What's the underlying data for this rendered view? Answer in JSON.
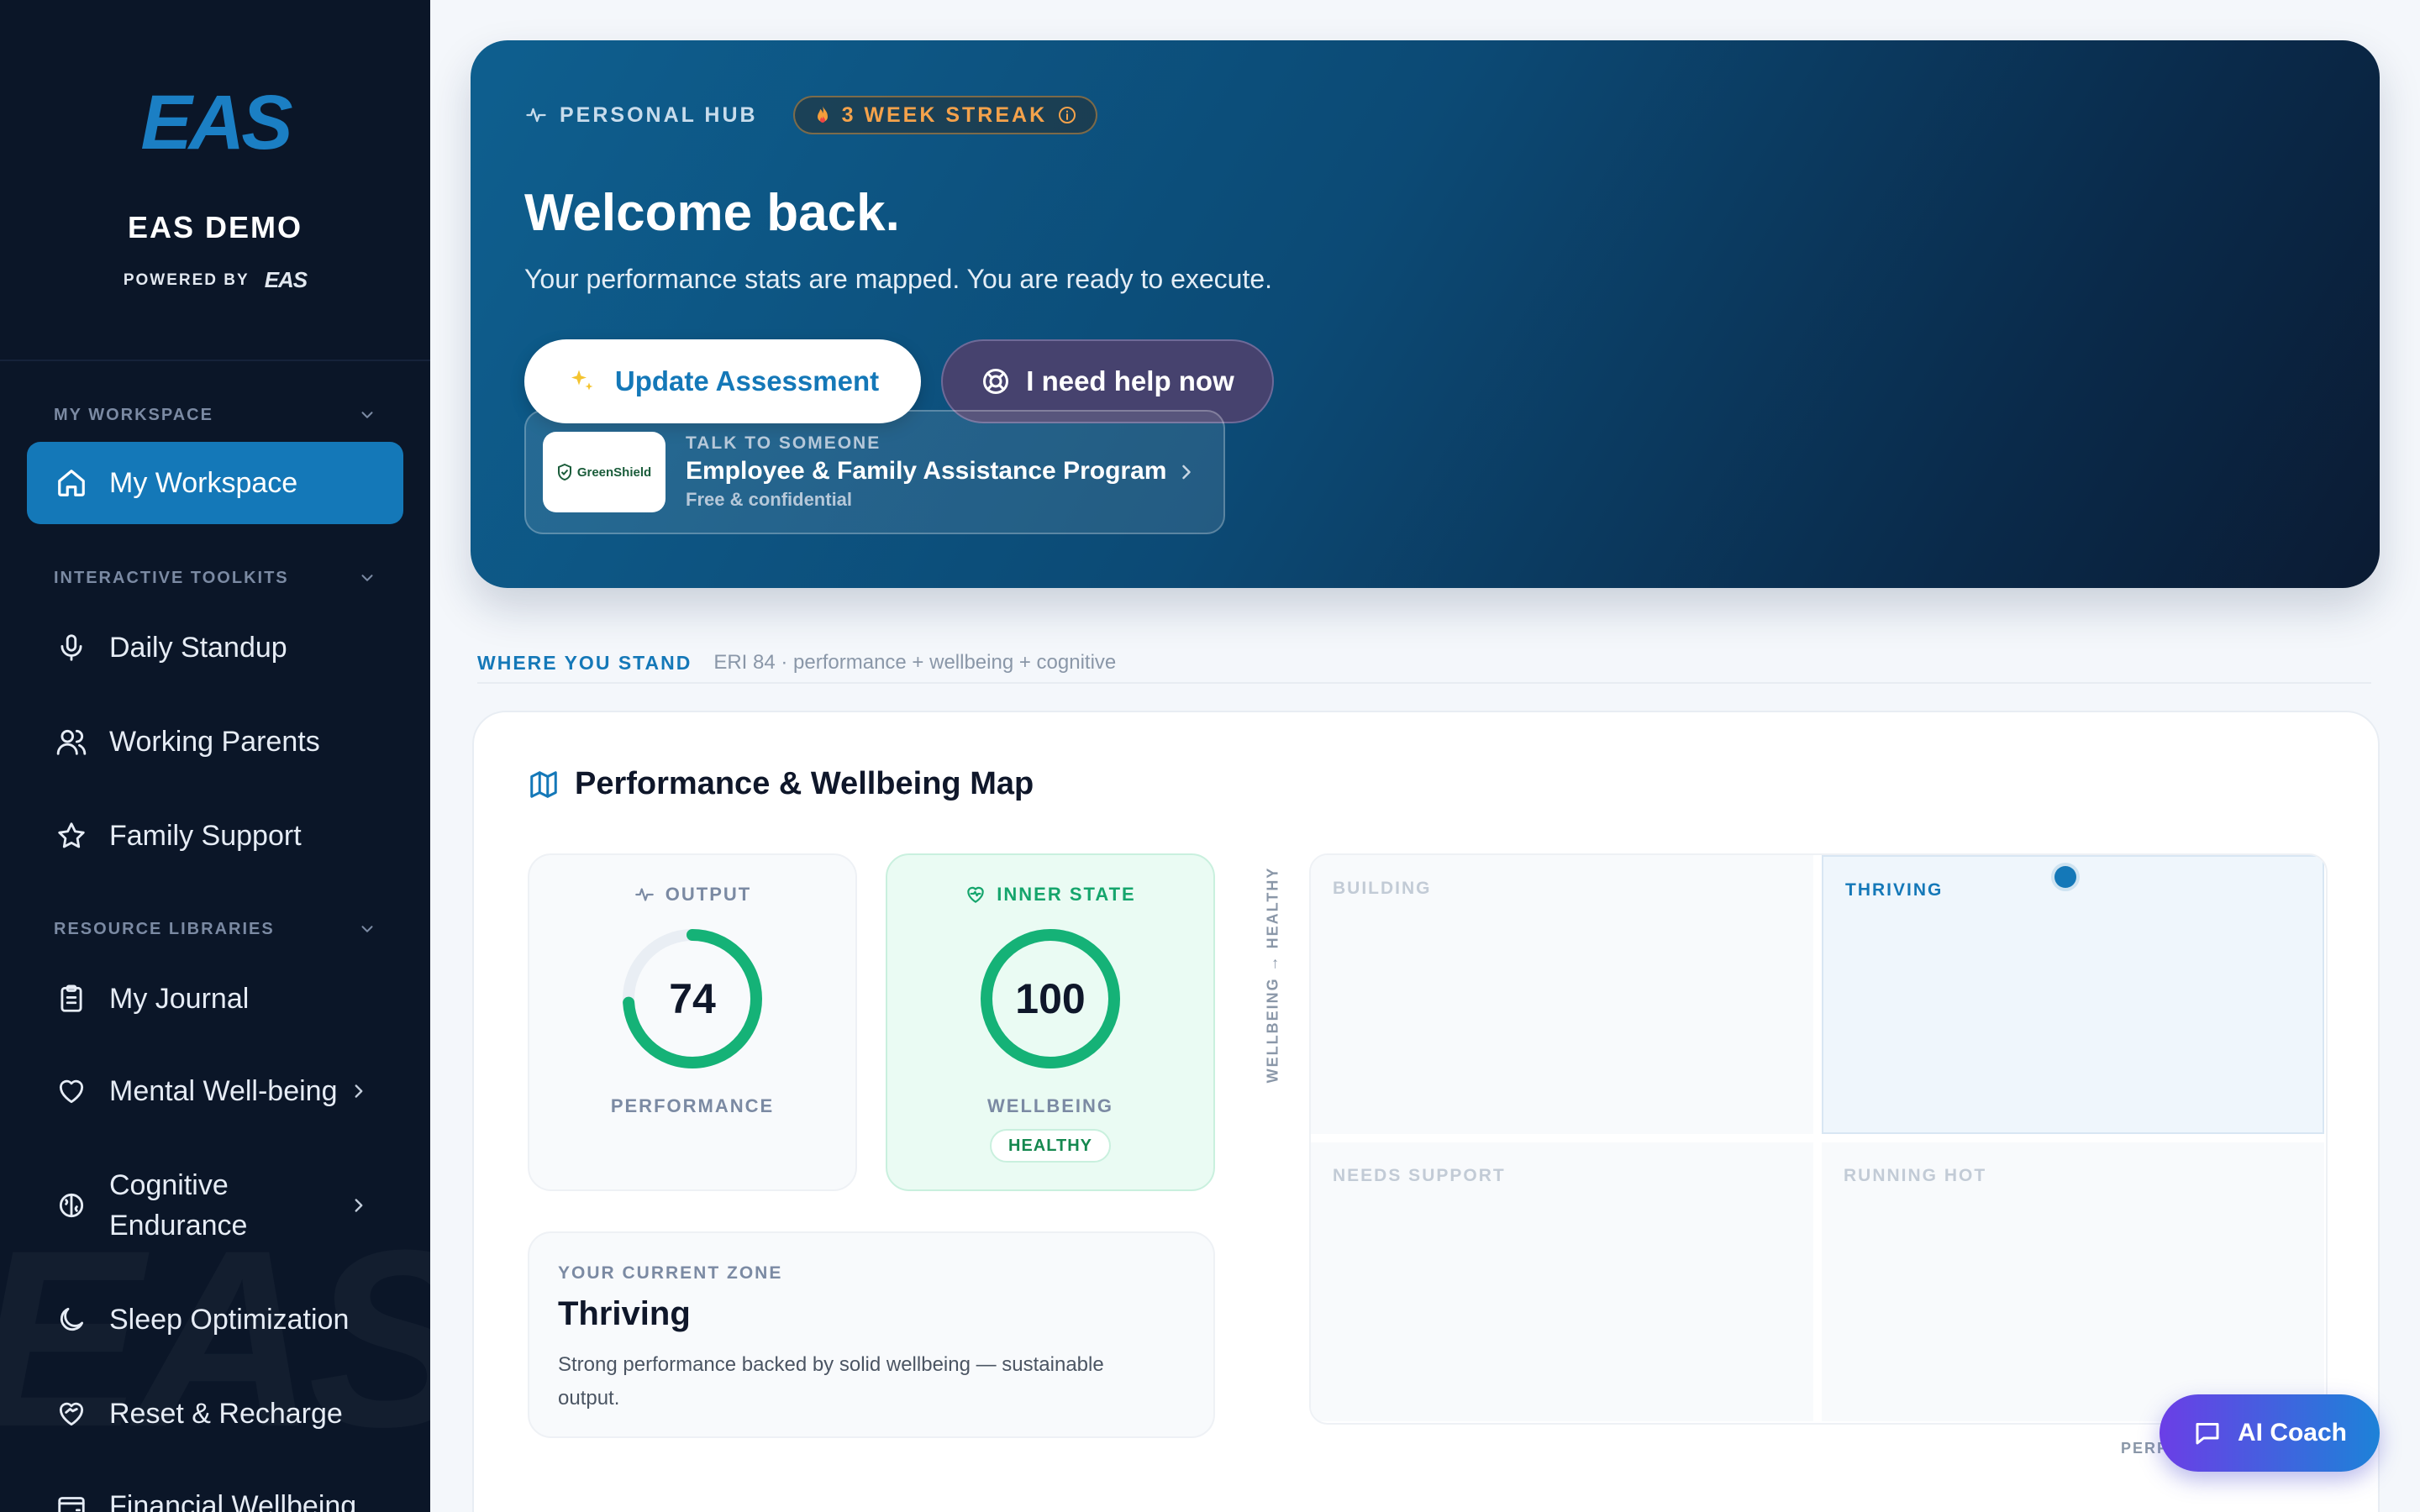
{
  "sidebar": {
    "logo_text": "EAS",
    "org_name": "EAS DEMO",
    "powered_by": "POWERED BY",
    "powered_logo": "EAS",
    "watermark": "EAS",
    "sections": {
      "workspace": "MY WORKSPACE",
      "toolkits": "INTERACTIVE TOOLKITS",
      "libraries": "RESOURCE LIBRARIES"
    },
    "items": {
      "my_workspace": "My Workspace",
      "daily_standup": "Daily Standup",
      "working_parents": "Working Parents",
      "family_support": "Family Support",
      "my_journal": "My Journal",
      "mental_wellbeing": "Mental Well-being",
      "cognitive_1": "Cognitive",
      "cognitive_2": "Endurance",
      "sleep": "Sleep Optimization",
      "reset": "Reset & Recharge",
      "financial": "Financial Wellbeing"
    }
  },
  "hero": {
    "tag": "PERSONAL HUB",
    "streak": "3 WEEK STREAK",
    "title": "Welcome back.",
    "subtitle": "Your performance stats are mapped. You are ready to execute.",
    "primary_button": "Update Assessment",
    "help_button": "I need help now",
    "eap": {
      "logo_text": "GreenShield",
      "kicker": "TALK TO SOMEONE",
      "title": "Employee & Family Assistance Program",
      "note": "Free & confidential"
    }
  },
  "stand": {
    "label": "WHERE YOU STAND",
    "meta": "ERI 84 · performance + wellbeing + cognitive"
  },
  "map": {
    "title": "Performance & Wellbeing Map",
    "output": {
      "head": "OUTPUT",
      "value": "74",
      "progress": 0.74,
      "label": "PERFORMANCE"
    },
    "inner": {
      "head": "INNER STATE",
      "value": "100",
      "progress": 1.0,
      "label": "WELLBEING",
      "status": "HEALTHY"
    },
    "zone": {
      "kicker": "YOUR CURRENT ZONE",
      "title": "Thriving",
      "description": "Strong performance backed by solid wellbeing — sustainable output."
    },
    "y_axis": "WELLBEING → HEALTHY",
    "x_axis": "PERF",
    "quadrants": {
      "building": "BUILDING",
      "thriving": "THRIVING",
      "needs_support": "NEEDS SUPPORT",
      "running_hot": "RUNNING HOT"
    }
  },
  "coach_button": "AI Coach",
  "colors": {
    "brand_blue": "#1478b8",
    "sidebar_bg": "#0b1628",
    "healthy_green": "#15a56c",
    "streak_orange": "#f5a24b"
  }
}
